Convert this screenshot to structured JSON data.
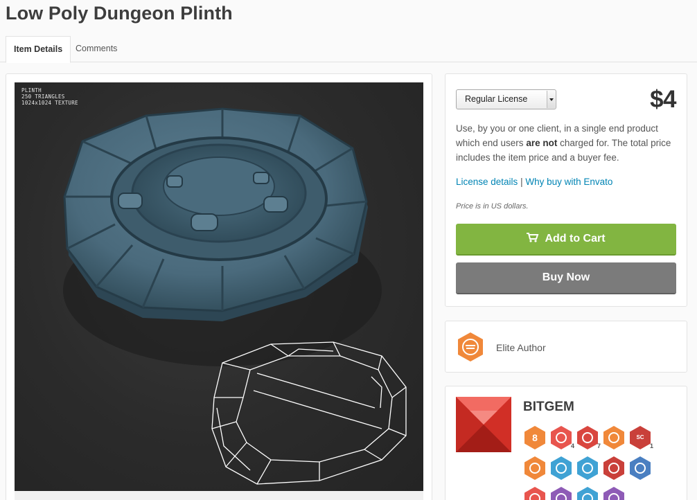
{
  "page": {
    "title": "Low Poly Dungeon Plinth"
  },
  "tabs": [
    {
      "label": "Item Details",
      "active": true
    },
    {
      "label": "Comments",
      "active": false
    }
  ],
  "preview": {
    "overlay_lines": [
      "PLINTH",
      "250 TRIANGLES",
      "1024x1024 TEXTURE"
    ]
  },
  "purchase": {
    "license_selected": "Regular License",
    "price": "$4",
    "desc_part1": "Use, by you or one client, in a single end product which end users ",
    "desc_bold": "are not",
    "desc_part2": " charged for. The total price includes the item price and a buyer fee.",
    "link_license": "License details",
    "link_separator": " | ",
    "link_why": "Why buy with Envato",
    "price_note": "Price is in US dollars.",
    "add_to_cart": "Add to Cart",
    "buy_now": "Buy Now"
  },
  "elite": {
    "label": "Elite Author"
  },
  "author": {
    "name": "BITGEM",
    "badges": [
      {
        "icon": "rank-8-badge-icon",
        "color": "#f0883a",
        "text": "8",
        "count": ""
      },
      {
        "icon": "link-badge-icon",
        "color": "#e8554e",
        "text": "",
        "count": "4"
      },
      {
        "icon": "paw-badge-icon",
        "color": "#d9463f",
        "text": "",
        "count": "7"
      },
      {
        "icon": "flask-badge-icon",
        "color": "#f0883a",
        "text": "",
        "count": ""
      },
      {
        "icon": "sc-badge-icon",
        "color": "#c9403a",
        "text": "SC",
        "count": "1"
      },
      {
        "icon": "stack-badge-icon",
        "color": "#f0883a",
        "text": "",
        "count": ""
      },
      {
        "icon": "person-badge-icon",
        "color": "#3fa2d4",
        "text": "",
        "count": ""
      },
      {
        "icon": "document-badge-icon",
        "color": "#3fa2d4",
        "text": "",
        "count": ""
      },
      {
        "icon": "bow-badge-icon",
        "color": "#c9403a",
        "text": "",
        "count": ""
      },
      {
        "icon": "newspaper-badge-icon",
        "color": "#4a7fc1",
        "text": "",
        "count": ""
      },
      {
        "icon": "location-badge-icon",
        "color": "#e8554e",
        "text": "",
        "count": ""
      },
      {
        "icon": "rocket-badge-icon",
        "color": "#8e5bb6",
        "text": "",
        "count": ""
      },
      {
        "icon": "bolt-badge-icon",
        "color": "#3fa2d4",
        "text": "",
        "count": ""
      },
      {
        "icon": "wizard-badge-icon",
        "color": "#8e5bb6",
        "text": "",
        "count": ""
      }
    ]
  },
  "colors": {
    "accent_link": "#0084b4",
    "cart_green": "#82b541",
    "buy_gray": "#7b7b7b",
    "elite_orange": "#f0883a"
  }
}
